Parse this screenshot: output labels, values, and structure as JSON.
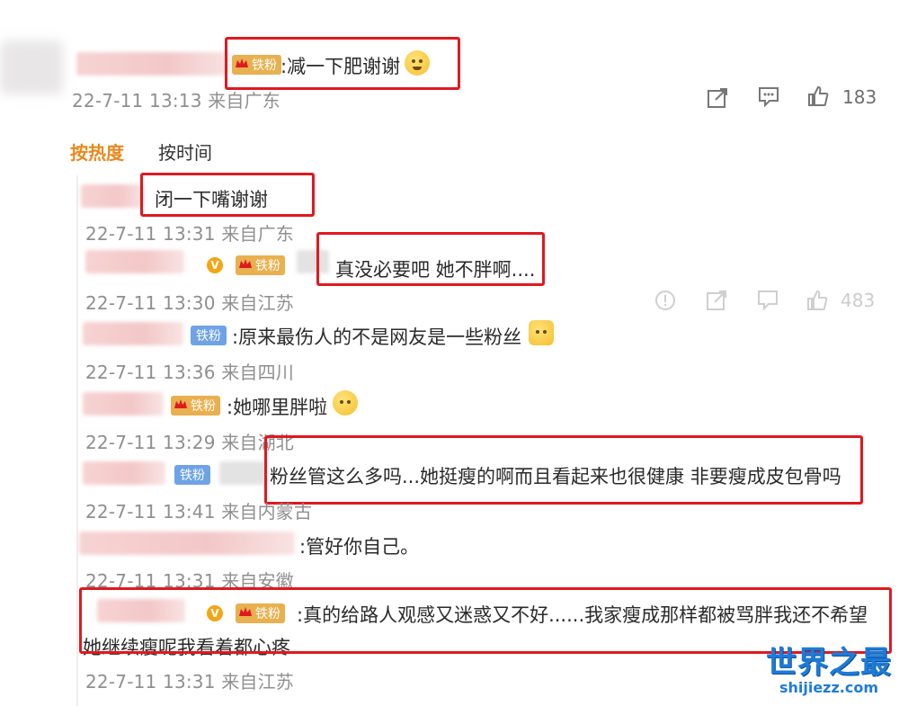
{
  "top_comment": {
    "badge": "铁粉",
    "text": ":减一下肥谢谢",
    "meta": "22-7-11 13:13 来自广东",
    "like_count": "183",
    "icons": [
      "share-icon",
      "comment-icon",
      "thumbs-up-icon"
    ]
  },
  "sort_tabs": [
    {
      "label": "按热度",
      "active": true
    },
    {
      "label": "按时间",
      "active": false
    }
  ],
  "replies": [
    {
      "text": "闭一下嘴谢谢",
      "meta": "22-7-11 13:31 来自广东"
    },
    {
      "badge": "铁粉",
      "text": "真没必要吧 她不胖啊....",
      "meta": "22-7-11 13:30 来自江苏",
      "like_count": "483"
    },
    {
      "badge": "铁粉",
      "text": ":原来最伤人的不是网友是一些粉丝",
      "meta": "22-7-11 13:36 来自四川"
    },
    {
      "badge": "铁粉",
      "text": ":她哪里胖啦",
      "meta": "22-7-11 13:29 来自湖北"
    },
    {
      "badge": "铁粉",
      "text": "粉丝管这么多吗...她挺瘦的啊而且看起来也很健康 非要瘦成皮包骨吗",
      "meta": "22-7-11 13:41 来自内蒙古"
    },
    {
      "text": ":管好你自己。",
      "meta": "22-7-11 13:31 来自安徽"
    },
    {
      "badge": "铁粉",
      "text": ":真的给路人观感又迷惑又不好......我家瘦成那样都被骂胖我还不希望",
      "text2": "她继续瘦呢我看着都心疼",
      "meta": "22-7-11 13:31 来自江苏"
    }
  ],
  "colors": {
    "accent": "#e8891c",
    "highlight_box": "#e0191f",
    "badge_gold": "#e9b04f",
    "badge_blue": "#6fa3e6"
  },
  "watermark": {
    "title": "世界之最",
    "url": "shijiezz.com"
  }
}
